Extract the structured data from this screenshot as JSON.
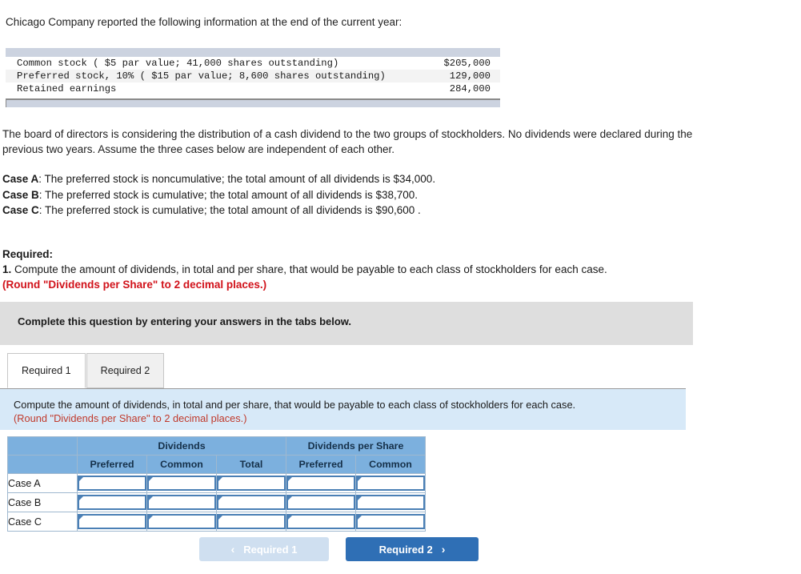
{
  "intro": "Chicago Company reported the following information at the end of the current year:",
  "fact_table": {
    "rows": [
      {
        "label": "Common stock ( $5 par value; 41,000 shares outstanding)",
        "value": "$205,000"
      },
      {
        "label": "Preferred stock, 10% ( $15 par value; 8,600 shares outstanding)",
        "value": "129,000"
      },
      {
        "label": "Retained earnings",
        "value": "284,000"
      }
    ]
  },
  "board_paragraph": "The board of directors is considering the distribution of a cash dividend to the two groups of stockholders. No dividends were declared during the previous two years. Assume the three cases below are independent of each other.",
  "cases": [
    {
      "name": "Case A",
      "text": ": The preferred stock is noncumulative; the total amount of all dividends is $34,000."
    },
    {
      "name": "Case B",
      "text": ": The preferred stock is cumulative; the total amount of all dividends is $38,700."
    },
    {
      "name": "Case C",
      "text": ": The preferred stock is cumulative; the total amount of all dividends is $90,600 ."
    }
  ],
  "required": {
    "title": "Required:",
    "item_number": "1.",
    "item_text": "Compute the amount of dividends, in total and per share, that would be payable to each class of stockholders for each case.",
    "round_note": "(Round \"Dividends per Share\" to 2 decimal places.)"
  },
  "gray_banner": "Complete this question by entering your answers in the tabs below.",
  "tabs": [
    {
      "label": "Required 1",
      "active": true
    },
    {
      "label": "Required 2",
      "active": false
    }
  ],
  "info_panel": {
    "line1": "Compute the amount of dividends, in total and per share, that would be payable to each class of stockholders for each case.",
    "line2": "(Round \"Dividends per Share\" to 2 decimal places.)"
  },
  "answer_table": {
    "group_headers": [
      {
        "label": "",
        "span": 1
      },
      {
        "label": "Dividends",
        "span": 3
      },
      {
        "label": "Dividends per Share",
        "span": 2
      }
    ],
    "sub_headers": [
      "",
      "Preferred",
      "Common",
      "Total",
      "Preferred",
      "Common"
    ],
    "rows": [
      {
        "label": "Case A",
        "cells": [
          "",
          "",
          "",
          "",
          ""
        ]
      },
      {
        "label": "Case B",
        "cells": [
          "",
          "",
          "",
          "",
          ""
        ]
      },
      {
        "label": "Case C",
        "cells": [
          "",
          "",
          "",
          "",
          ""
        ]
      }
    ]
  },
  "nav": {
    "prev_label": "Required 1",
    "prev_chevron": "‹",
    "next_label": "Required 2",
    "next_chevron": "›"
  },
  "colors": {
    "header_blue": "#7cb0de",
    "panel_blue": "#d7e9f8",
    "banner_gray": "#dedede",
    "accent_red": "#c0392b",
    "button_blue": "#2f6fb5",
    "button_disabled": "#cfdff0"
  }
}
